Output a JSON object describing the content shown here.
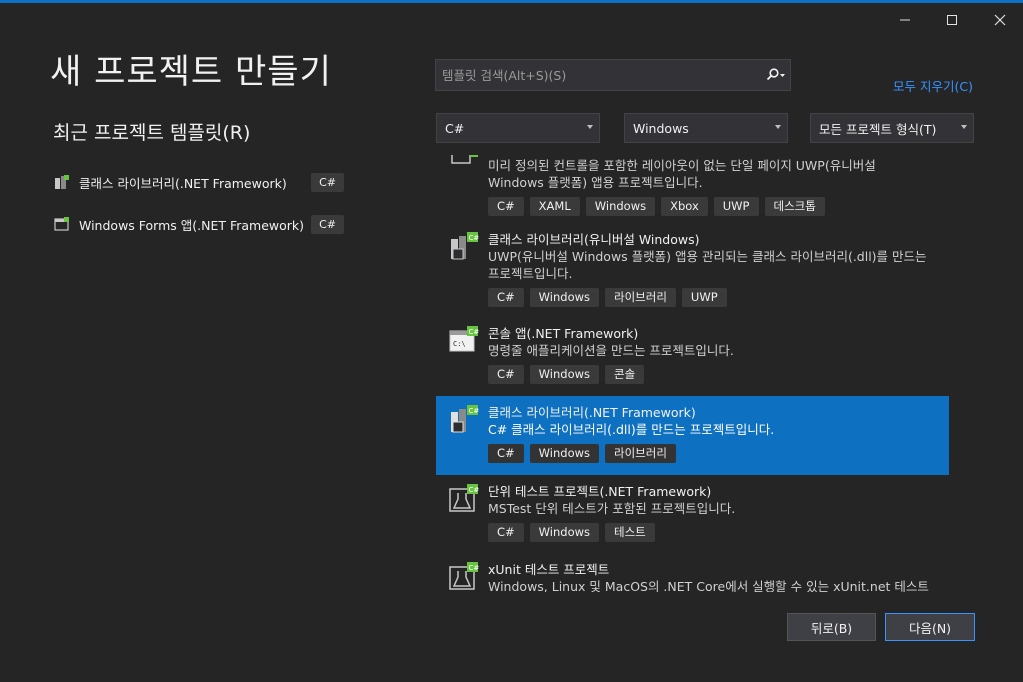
{
  "window": {
    "title": "새 프로젝트 만들기",
    "recent_title": "최근 프로젝트 템플릿(R)"
  },
  "recent_templates": [
    {
      "name": "클래스 라이브러리(.NET Framework)",
      "lang": "C#",
      "icon": "class-library-icon"
    },
    {
      "name": "Windows Forms 앱(.NET Framework)",
      "lang": "C#",
      "icon": "windows-forms-icon"
    }
  ],
  "search": {
    "placeholder": "템플릿 검색(Alt+S)(S)",
    "value": "",
    "icon": "search-icon"
  },
  "clear_all_label": "모두 지우기(C)",
  "filters": {
    "language": "C#",
    "platform": "Windows",
    "project_type": "모든 프로젝트 형식(T)"
  },
  "templates": [
    {
      "name": "",
      "desc": "미리 정의된 컨트롤을 포함한 레이아웃이 없는 단일 페이지 UWP(유니버설 Windows 플랫폼) 앱용 프로젝트입니다.",
      "tags": [
        "C#",
        "XAML",
        "Windows",
        "Xbox",
        "UWP",
        "데스크톱"
      ],
      "icon": "blank-app-icon"
    },
    {
      "name": "클래스 라이브러리(유니버설 Windows)",
      "desc": "UWP(유니버설 Windows 플랫폼) 앱용 관리되는 클래스 라이브러리(.dll)를 만드는 프로젝트입니다.",
      "tags": [
        "C#",
        "Windows",
        "라이브러리",
        "UWP"
      ],
      "icon": "class-library-icon"
    },
    {
      "name": "콘솔 앱(.NET Framework)",
      "desc": "명령줄 애플리케이션을 만드는 프로젝트입니다.",
      "tags": [
        "C#",
        "Windows",
        "콘솔"
      ],
      "icon": "console-app-icon"
    },
    {
      "name": "클래스 라이브러리(.NET Framework)",
      "desc": "C# 클래스 라이브러리(.dll)를 만드는 프로젝트입니다.",
      "tags": [
        "C#",
        "Windows",
        "라이브러리"
      ],
      "icon": "class-library-icon",
      "selected": true
    },
    {
      "name": "단위 테스트 프로젝트(.NET Framework)",
      "desc": "MSTest 단위 테스트가 포함된 프로젝트입니다.",
      "tags": [
        "C#",
        "Windows",
        "테스트"
      ],
      "icon": "unit-test-icon"
    },
    {
      "name": "xUnit 테스트 프로젝트",
      "desc": "Windows, Linux 및 MacOS의 .NET Core에서 실행할 수 있는 xUnit.net 테스트를 포",
      "tags": [],
      "icon": "xunit-test-icon"
    }
  ],
  "buttons": {
    "back": "뒤로(B)",
    "next": "다음(N)"
  },
  "colors": {
    "background": "#252526",
    "accent": "#0e70c0",
    "link": "#3794ff",
    "csharp_badge": "#68c341"
  }
}
